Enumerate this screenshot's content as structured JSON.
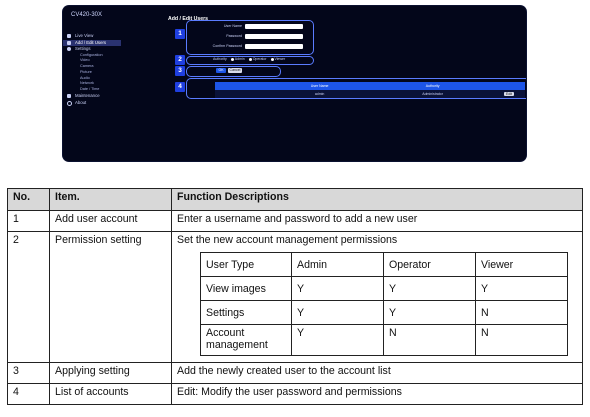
{
  "screenshot": {
    "model_name": "CV420-30X",
    "nav": [
      {
        "label": "Live View",
        "icon": "camera-icon",
        "level": "top",
        "active": false
      },
      {
        "label": "Add / Edit Users",
        "icon": "user-icon",
        "level": "top",
        "active": true
      },
      {
        "label": "Settings",
        "icon": "gear-icon",
        "level": "top",
        "active": false
      },
      {
        "label": "Configuration",
        "level": "sub",
        "active": false
      },
      {
        "label": "Video",
        "level": "sub",
        "active": false
      },
      {
        "label": "Camera",
        "level": "sub",
        "active": false
      },
      {
        "label": "Picture",
        "level": "sub",
        "active": false
      },
      {
        "label": "Audio",
        "level": "sub",
        "active": false
      },
      {
        "label": "Network",
        "level": "sub",
        "active": false
      },
      {
        "label": "Date / Time",
        "level": "sub",
        "active": false
      },
      {
        "label": "Maintenance",
        "icon": "wrench-icon",
        "level": "top",
        "active": false
      },
      {
        "label": "About",
        "icon": "info-icon",
        "level": "top",
        "active": false
      }
    ],
    "page_heading": "Add / Edit Users",
    "fields": [
      {
        "label": "User Name"
      },
      {
        "label": "Password"
      },
      {
        "label": "Confirm Password"
      }
    ],
    "authority_label": "Authority",
    "authority_options": [
      "Admin",
      "Operator",
      "Viewer"
    ],
    "ok_label": "OK",
    "cancel_label": "Cancel",
    "accounts_headers": [
      "",
      "User Name",
      "Authority",
      ""
    ],
    "accounts_rows": [
      {
        "user": "admin",
        "authority": "Administrator",
        "action": "Edit"
      }
    ],
    "callouts": [
      "1",
      "2",
      "3",
      "4"
    ],
    "colors": {
      "panel_bg": "#03061a",
      "accent": "#1f3fe0",
      "callout_border": "#5a7bff"
    }
  },
  "function_table": {
    "headers": {
      "no": "No.",
      "item": "Item.",
      "desc": "Function Descriptions"
    },
    "rows": [
      {
        "no": "1",
        "item": "Add user account",
        "desc": "Enter a username and password to add a new user"
      },
      {
        "no": "2",
        "item": "Permission setting",
        "desc": "Set the new account management permissions"
      },
      {
        "no": "3",
        "item": "Applying setting",
        "desc": "Add the newly created user to the account list"
      },
      {
        "no": "4",
        "item": "List of accounts",
        "desc": "Edit: Modify the user password and permissions"
      }
    ],
    "permissions": {
      "header": [
        "User Type",
        "Admin",
        "Operator",
        "Viewer"
      ],
      "rows": [
        [
          "View images",
          "Y",
          "Y",
          "Y"
        ],
        [
          "Settings",
          "Y",
          "Y",
          "N"
        ],
        [
          "Account management",
          "Y",
          "N",
          "N"
        ]
      ]
    }
  }
}
